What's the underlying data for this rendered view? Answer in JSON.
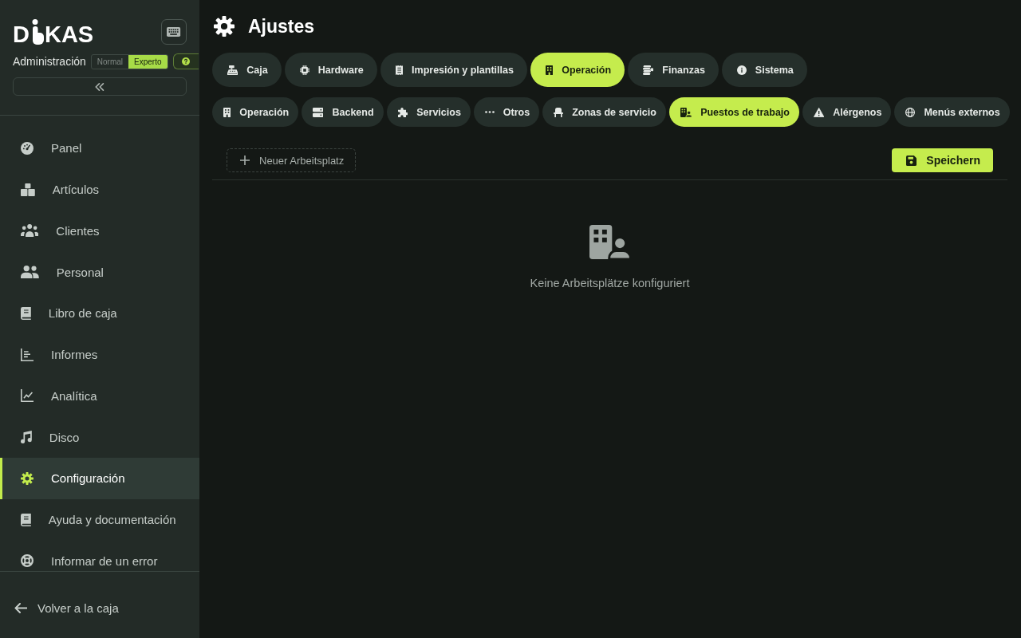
{
  "sidebar": {
    "logo": {
      "text_before_icon": "D",
      "text_after_icon": "KAS"
    },
    "subtitle": "Administración",
    "mode_options": [
      {
        "label": "Normal",
        "selected": false
      },
      {
        "label": "Experto",
        "selected": true
      }
    ],
    "nav_items": [
      {
        "label": "Panel",
        "selected": false
      },
      {
        "label": "Artículos",
        "selected": false
      },
      {
        "label": "Clientes",
        "selected": false
      },
      {
        "label": "Personal",
        "selected": false
      },
      {
        "label": "Libro de caja",
        "selected": false
      },
      {
        "label": "Informes",
        "selected": false
      },
      {
        "label": "Analítica",
        "selected": false
      },
      {
        "label": "Disco",
        "selected": false
      },
      {
        "label": "Configuración",
        "selected": true
      },
      {
        "label": "Ayuda y documentación",
        "selected": false
      },
      {
        "label": "Informar de un error",
        "selected": false
      }
    ],
    "back_link": "Volver a la caja"
  },
  "header": {
    "title": "Ajustes"
  },
  "section_tabs": [
    {
      "label": "Caja",
      "selected": false
    },
    {
      "label": "Hardware",
      "selected": false
    },
    {
      "label": "Impresión y plantillas",
      "selected": false
    },
    {
      "label": "Operación",
      "selected": true
    },
    {
      "label": "Finanzas",
      "selected": false
    },
    {
      "label": "Sistema",
      "selected": false
    }
  ],
  "subsection_tabs": [
    {
      "label": "Operación",
      "selected": false
    },
    {
      "label": "Backend",
      "selected": false
    },
    {
      "label": "Servicios",
      "selected": false
    },
    {
      "label": "Otros",
      "selected": false
    },
    {
      "label": "Zonas de servicio",
      "selected": false
    },
    {
      "label": "Puestos de trabajo",
      "selected": true
    },
    {
      "label": "Alérgenos",
      "selected": false
    },
    {
      "label": "Menús externos",
      "selected": false
    }
  ],
  "toolbar": {
    "add_button": "Neuer Arbeitsplatz",
    "save_button": "Speichern"
  },
  "empty_state": {
    "message": "Keine Arbeitsplätze konfiguriert"
  }
}
